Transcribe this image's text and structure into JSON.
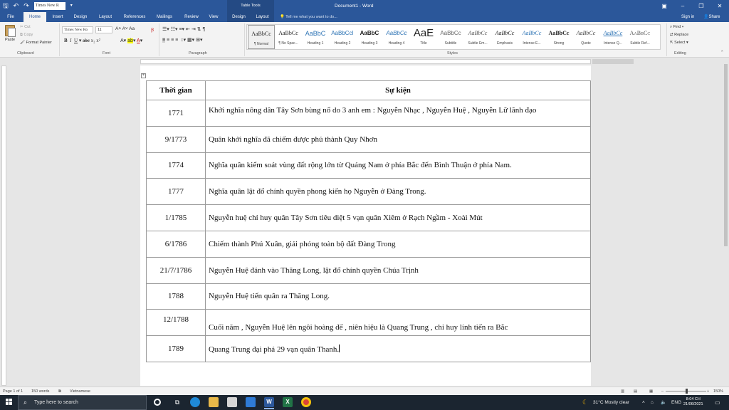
{
  "titlebar": {
    "font_box": "Times New R",
    "contextual_tab_group": "Table Tools",
    "document_title": "Document1 - Word"
  },
  "tabs": [
    "File",
    "Home",
    "Insert",
    "Design",
    "Layout",
    "References",
    "Mailings",
    "Review",
    "View",
    "Design",
    "Layout"
  ],
  "tell_me": "Tell me what you want to do...",
  "account": {
    "sign_in": "Sign in",
    "share": "Share"
  },
  "ribbon": {
    "clipboard": {
      "paste": "Paste",
      "cut": "Cut",
      "copy": "Copy",
      "format_painter": "Format Painter",
      "label": "Clipboard"
    },
    "font": {
      "name": "Times New Ro",
      "size": "11",
      "label": "Font"
    },
    "paragraph": {
      "label": "Paragraph"
    },
    "styles": {
      "label": "Styles",
      "items": [
        {
          "sample": "AaBbCc",
          "name": "¶ Normal"
        },
        {
          "sample": "AaBbCc",
          "name": "¶ No Spac..."
        },
        {
          "sample": "AaBbC",
          "name": "Heading 1"
        },
        {
          "sample": "AaBbCcI",
          "name": "Heading 2"
        },
        {
          "sample": "AaBbC",
          "name": "Heading 3"
        },
        {
          "sample": "AaBbCc",
          "name": "Heading 4"
        },
        {
          "sample": "AaE",
          "name": "Title"
        },
        {
          "sample": "AaBbCc",
          "name": "Subtitle"
        },
        {
          "sample": "AaBbCc",
          "name": "Subtle Em..."
        },
        {
          "sample": "AaBbCc",
          "name": "Emphasis"
        },
        {
          "sample": "AaBbCc",
          "name": "Intense E..."
        },
        {
          "sample": "AaBbCc",
          "name": "Strong"
        },
        {
          "sample": "AaBbCc",
          "name": "Quote"
        },
        {
          "sample": "AaBbCc",
          "name": "Intense Q..."
        },
        {
          "sample": "AaBbCc",
          "name": "Subtle Ref..."
        }
      ]
    },
    "editing": {
      "find": "Find",
      "replace": "Replace",
      "select": "Select",
      "label": "Editing"
    }
  },
  "table": {
    "headers": [
      "Thời gian",
      "Sự kiện"
    ],
    "rows": [
      {
        "time": "1771",
        "event": "Khởi nghĩa nông dân Tây Sơn bùng nổ do 3 anh em : Nguyễn Nhạc , Nguyễn Huệ , Nguyễn Lữ lãnh đạo"
      },
      {
        "time": "9/1773",
        "event": "Quân khởi nghĩa đã chiếm được phủ thành Quy Nhơn"
      },
      {
        "time": "1774",
        "event": "Nghĩa quân kiểm soát vùng đất rộng lớn từ Quảng Nam ở phía Bắc đến Bình Thuận ở phía Nam."
      },
      {
        "time": "1777",
        "event": "Nghĩa quân lật đổ chính quyền phong kiến họ Nguyễn ở Đàng Trong."
      },
      {
        "time": "1/1785",
        "event": "Nguyễn huệ chỉ huy quân Tây Sơn tiêu diệt 5 vạn quân Xiêm ở Rạch Ngầm - Xoài Mút"
      },
      {
        "time": "6/1786",
        "event": "Chiếm thành Phú Xuân, giải phóng toàn bộ đất Đàng Trong"
      },
      {
        "time": "21/7/1786",
        "event": "Nguyễn Huệ đánh vào Thăng Long, lật đổ chính quyền Chúa Trịnh"
      },
      {
        "time": "1788",
        "event": "Nguyễn Huệ tiến quân ra Thăng Long."
      },
      {
        "time": "12/1788",
        "event": "Cuối năm , Nguyễn Huệ lên ngôi hoàng đế , niên hiệu là Quang Trung , chỉ huy lính tiến ra Bắc"
      },
      {
        "time": "1789",
        "event": "Quang Trung đại phá 29 vạn quân Thanh."
      }
    ]
  },
  "statusbar": {
    "page": "Page 1 of 1",
    "words": "150 words",
    "language": "Vietnamese",
    "zoom": "150%"
  },
  "taskbar": {
    "search_placeholder": "Type here to search",
    "weather": "31°C  Mostly clear",
    "lang": "ENG",
    "time": "8:04 CH",
    "date": "21/06/2021"
  }
}
